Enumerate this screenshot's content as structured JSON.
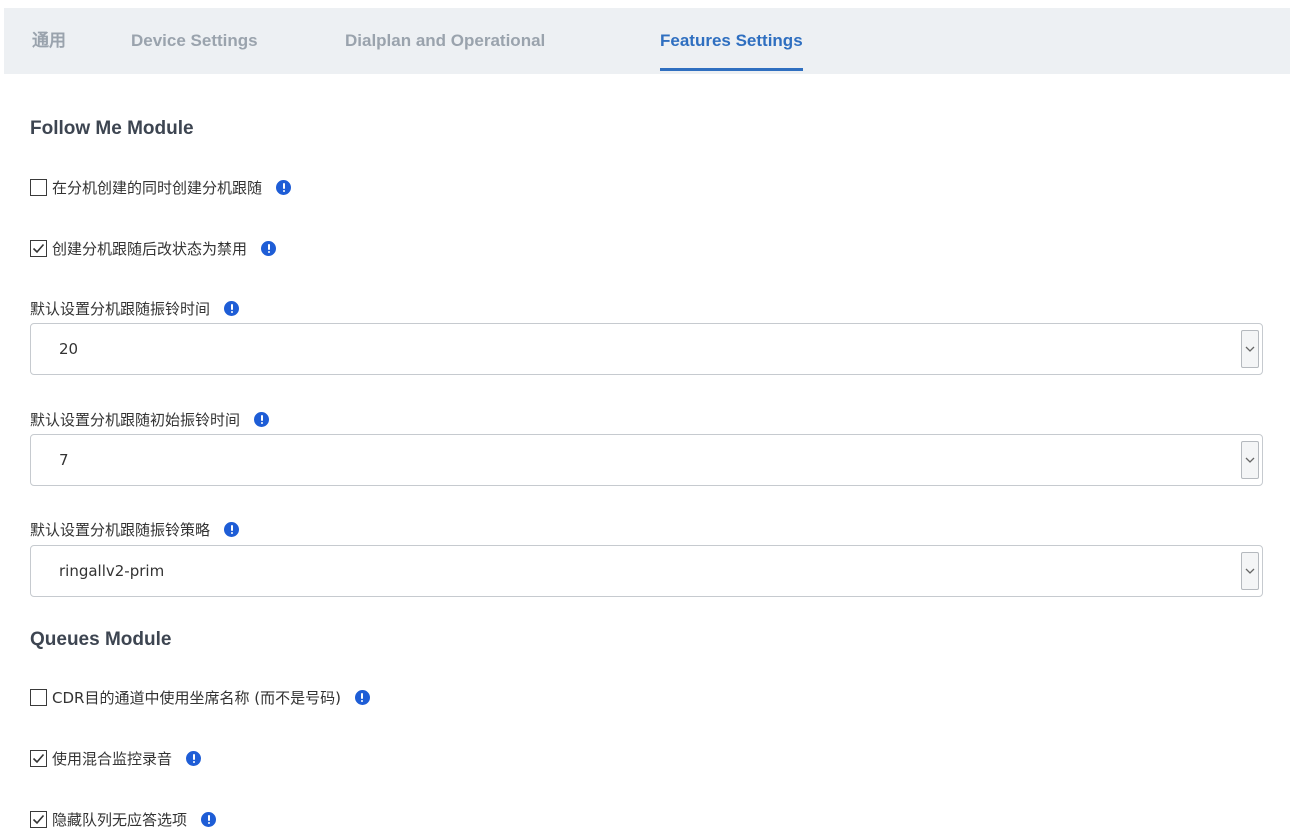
{
  "tabs": [
    {
      "label": "通用",
      "active": false
    },
    {
      "label": "Device Settings",
      "active": false
    },
    {
      "label": "Dialplan and Operational",
      "active": false
    },
    {
      "label": "Features Settings",
      "active": true
    }
  ],
  "follow_me": {
    "title": "Follow Me Module",
    "create_with_extension": {
      "label": "在分机创建的同时创建分机跟随",
      "checked": false
    },
    "disable_after_create": {
      "label": "创建分机跟随后改状态为禁用",
      "checked": true
    },
    "ring_time": {
      "label": "默认设置分机跟随振铃时间",
      "value": "20"
    },
    "initial_ring_time": {
      "label": "默认设置分机跟随初始振铃时间",
      "value": "7"
    },
    "ring_strategy": {
      "label": "默认设置分机跟随振铃策略",
      "value": "ringallv2-prim"
    }
  },
  "queues": {
    "title": "Queues Module",
    "cdr_agent_name": {
      "label": "CDR目的通道中使用坐席名称 (而不是号码)",
      "checked": false
    },
    "mixed_monitor": {
      "label": "使用混合监控录音",
      "checked": true
    },
    "hide_no_answer": {
      "label": "隐藏队列无应答选项",
      "checked": true
    }
  },
  "colors": {
    "accent": "#2f6fc0",
    "info_icon": "#1e5dd6",
    "tab_bg": "#edf0f3"
  }
}
